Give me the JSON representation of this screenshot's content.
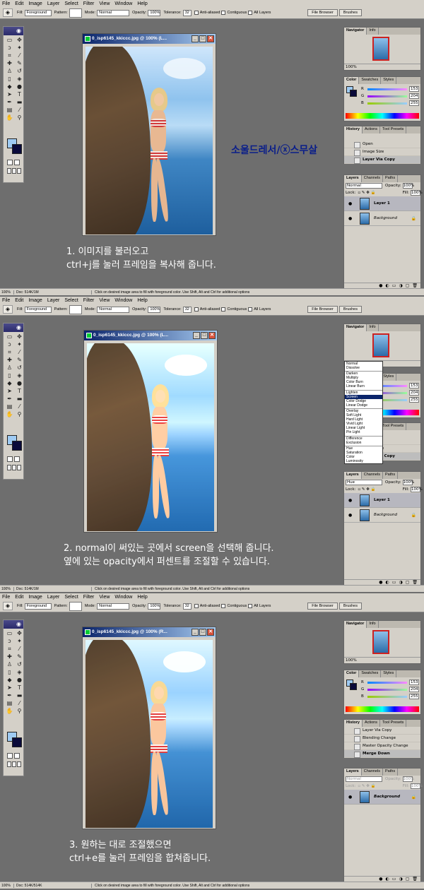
{
  "menu": [
    "File",
    "Edit",
    "Image",
    "Layer",
    "Select",
    "Filter",
    "View",
    "Window",
    "Help"
  ],
  "options_bar": {
    "fill_label": "Fill:",
    "fill_value": "Foreground",
    "pattern_label": "Pattern:",
    "mode_label": "Mode:",
    "mode_value": "Normal",
    "opacity_label": "Opacity:",
    "opacity_value": "100%",
    "tolerance_label": "Tolerance:",
    "tolerance_value": "32",
    "anti_aliased": "Anti-aliased",
    "contiguous": "Contiguous",
    "all_layers": "All Layers",
    "file_browser": "File Browser",
    "brushes": "Brushes"
  },
  "document": {
    "title": "0_isp6145_kkiccc.jpg @ 100% (L...",
    "title3": "0_isp6145_kkiccc.jpg @ 100% (R..."
  },
  "navigator": {
    "tab1": "Navigator",
    "tab2": "Info",
    "zoom": "100%"
  },
  "color": {
    "tabs": [
      "Color",
      "Swatches",
      "Styles"
    ],
    "r_label": "R",
    "g_label": "G",
    "b_label": "B",
    "r": "153",
    "g": "204",
    "b": "255",
    "fg": "#9fcbf3",
    "bg": "#0a0a3a"
  },
  "history": {
    "tabs": [
      "History",
      "Actions",
      "Tool Presets"
    ],
    "panel1": [
      "Open",
      "Image Size",
      "Layer Via Copy"
    ],
    "panel3": [
      "Layer Via Copy",
      "Blending Change",
      "Master Opacity Change",
      "Merge Down"
    ]
  },
  "layers": {
    "tabs": [
      "Layers",
      "Channels",
      "Paths"
    ],
    "blend_mode": "Normal",
    "opacity_label": "Opacity:",
    "opacity": "100%",
    "lock_label": "Lock:",
    "fill_label": "Fill:",
    "fill": "100%",
    "layer1": "Layer 1",
    "background": "Background"
  },
  "blend_modes": {
    "visible_value": "Hue",
    "groups": [
      [
        "Normal",
        "Dissolve"
      ],
      [
        "Darken",
        "Multiply",
        "Color Burn",
        "Linear Burn"
      ],
      [
        "Lighten",
        "Screen",
        "Color Dodge",
        "Linear Dodge"
      ],
      [
        "Overlay",
        "Soft Light",
        "Hard Light",
        "Vivid Light",
        "Linear Light",
        "Pin Light"
      ],
      [
        "Difference",
        "Exclusion"
      ],
      [
        "Hue",
        "Saturation",
        "Color",
        "Luminosity"
      ]
    ],
    "highlighted": "Screen"
  },
  "status": {
    "zoom": "100%",
    "doc1": "Doc: 514K/1M",
    "doc3": "Doc: 514K/514K",
    "message": "Click on desired image area to fill with foreground color. Use Shift, Alt and Ctrl for additional options"
  },
  "signature": "소울드레서/ⓧ스무살",
  "annotations": {
    "step1_line1": "1. 이미지를 불러오고",
    "step1_line2": "ctrl+j를 눌러 프레임을 복사해 줍니다.",
    "step2_line1": "2. normal이 써있는 곳에서 screen을 선택해 줍니다.",
    "step2_line2": "옆에 있는 opacity에서 퍼센트를 조절할 수 있습니다.",
    "step3_line1": "3. 원하는 대로 조절했으면",
    "step3_line2": "ctrl+e를 눌러 프레임을 합쳐줍니다."
  },
  "icons": [
    "paint-bucket-icon",
    "eye-icon",
    "brush-icon",
    "lock-icon",
    "close-icon",
    "minimize-icon",
    "maximize-icon"
  ]
}
